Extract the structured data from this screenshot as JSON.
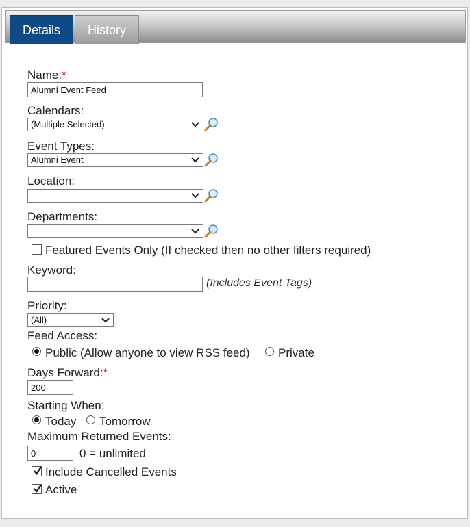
{
  "tabs": [
    {
      "label": "Details",
      "active": true
    },
    {
      "label": "History",
      "active": false
    }
  ],
  "colors": {
    "accent": "#0d4a86",
    "required": "#d00000"
  },
  "form": {
    "name": {
      "label": "Name:",
      "required_mark": "*",
      "value": "Alumni Event Feed"
    },
    "calendars": {
      "label": "Calendars:",
      "selected": "(Multiple Selected)",
      "lookup_icon": "magnifier-icon"
    },
    "event_types": {
      "label": "Event Types:",
      "selected": "Alumni Event"
    },
    "location": {
      "label": "Location:",
      "selected": ""
    },
    "departments": {
      "label": "Departments:",
      "selected": ""
    },
    "featured": {
      "label": "Featured Events Only (If checked then no other filters required)",
      "checked": false
    },
    "keyword": {
      "label": "Keyword:",
      "value": "",
      "hint": "(Includes Event Tags)"
    },
    "priority": {
      "label": "Priority:",
      "selected": "(All)"
    },
    "feed_access": {
      "label": "Feed Access:",
      "options": [
        "Public (Allow anyone to view RSS feed)",
        "Private"
      ],
      "selected": "Public (Allow anyone to view RSS feed)"
    },
    "days_forward": {
      "label": "Days Forward:",
      "required_mark": "*",
      "value": "200"
    },
    "starting_when": {
      "label": "Starting When:",
      "options": [
        "Today",
        "Tomorrow"
      ],
      "selected": "Today"
    },
    "max_events": {
      "label": "Maximum Returned Events:",
      "value": "0",
      "hint": "0 = unlimited"
    },
    "include_cancelled": {
      "label": "Include Cancelled Events",
      "checked": true
    },
    "active": {
      "label": "Active",
      "checked": true
    }
  }
}
